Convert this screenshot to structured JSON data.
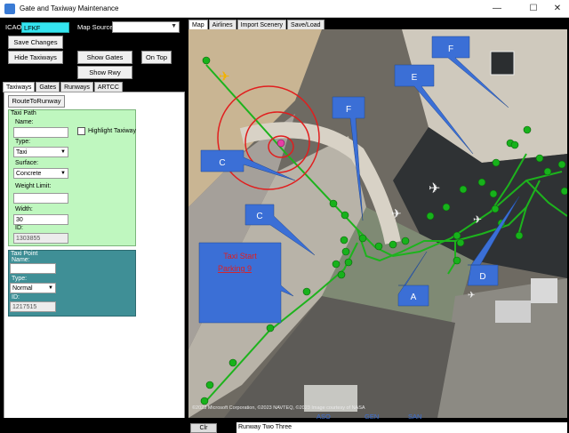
{
  "window": {
    "title": "Gate and Taxiway Maintenance",
    "min_glyph": "—",
    "max_glyph": "☐",
    "close_glyph": "✕"
  },
  "top": {
    "icao_label": "ICAO",
    "icao_value": "LFKF",
    "map_source_label": "Map Source:",
    "map_source_value": "",
    "save_changes": "Save Changes",
    "hide_taxiways": "Hide Taxiways",
    "show_gates": "Show Gates",
    "on_top": "On Top",
    "show_rwy_names": "Show Rwy Names"
  },
  "left_tabs": [
    "Taxiways",
    "Gates",
    "Runways",
    "ARTCC"
  ],
  "taxi_panel": {
    "route_to_runway": "RouteToRunway",
    "taxi_path_label": "Taxi Path",
    "name_label": "Name:",
    "name_value": "",
    "highlight_taxiway": "Highlight Taxiway",
    "type_label": "Type:",
    "type_value": "Taxi",
    "surface_label": "Surface:",
    "surface_value": "Concrete",
    "weight_label": "Weight Limit:",
    "weight_value": "",
    "width_label": "Width:",
    "width_value": "30",
    "id_label": "ID:",
    "id_value": "1303855"
  },
  "taxi_point": {
    "label": "Taxi Point",
    "name_label": "Name:",
    "name_value": "",
    "type_label": "Type:",
    "type_value": "Normal",
    "id_label": "ID:",
    "id_value": "1217515"
  },
  "map_tabs": [
    "Map",
    "Airlines",
    "Import Scenery",
    "Save/Load"
  ],
  "map": {
    "callouts": [
      "F",
      "E",
      "F",
      "C",
      "C",
      "A",
      "D"
    ],
    "taxi_start_label": "Taxi Start\nParking  9",
    "attribution": "©2023 Microsoft Corporation, ©2023 NAVTEQ, ©2023 Image courtesy of NASA",
    "freq_labels": [
      "ASO",
      "GEN",
      "SAN"
    ]
  },
  "bottom": {
    "clr": "Clr",
    "runway_field": "Runway Two Three"
  },
  "colors": {
    "icao_bg": "#34e4f0",
    "green_panel": "#bff7bf",
    "teal_panel": "#3f8f96",
    "taxiway_line": "#1db31d",
    "callout_blue": "#3b6fd6",
    "annotation_red": "#e11e1e"
  }
}
